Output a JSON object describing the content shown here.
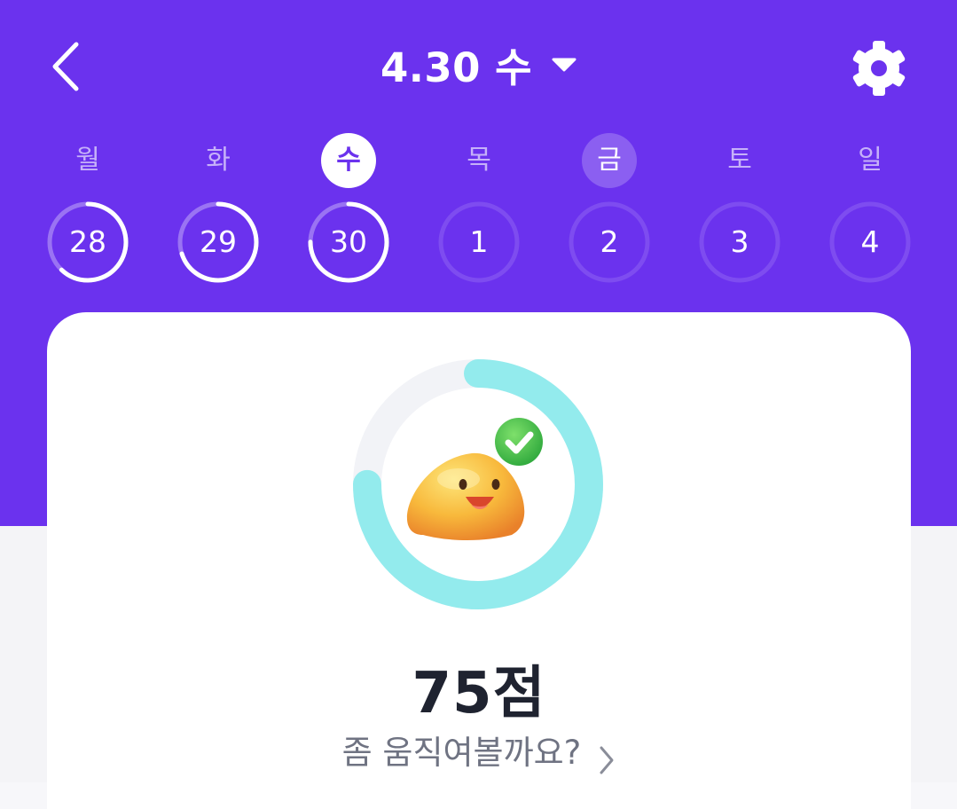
{
  "header": {
    "title": "4.30 수",
    "back_icon": "chevron-left-icon",
    "dropdown_icon": "caret-down-icon",
    "settings_icon": "gear-icon"
  },
  "week": [
    {
      "weekday": "월",
      "date": "28",
      "state": "past",
      "progress": 0.62
    },
    {
      "weekday": "화",
      "date": "29",
      "state": "past",
      "progress": 0.7
    },
    {
      "weekday": "수",
      "date": "30",
      "state": "selected",
      "progress": 0.75
    },
    {
      "weekday": "목",
      "date": "1",
      "state": "future",
      "progress": 0
    },
    {
      "weekday": "금",
      "date": "2",
      "state": "today",
      "progress": 0
    },
    {
      "weekday": "토",
      "date": "3",
      "state": "future",
      "progress": 0
    },
    {
      "weekday": "일",
      "date": "4",
      "state": "future",
      "progress": 0
    }
  ],
  "score_card": {
    "score": "75점",
    "score_value": 75,
    "score_max": 100,
    "message": "좀 움직여볼까요?",
    "character_icon": "smiling-blob-with-check-icon",
    "ring_color": "#93ebed",
    "ring_track_color": "#f2f3f7"
  },
  "colors": {
    "brand": "#6b32ee",
    "text_dark": "#1f2330",
    "text_muted": "#6f7382"
  }
}
